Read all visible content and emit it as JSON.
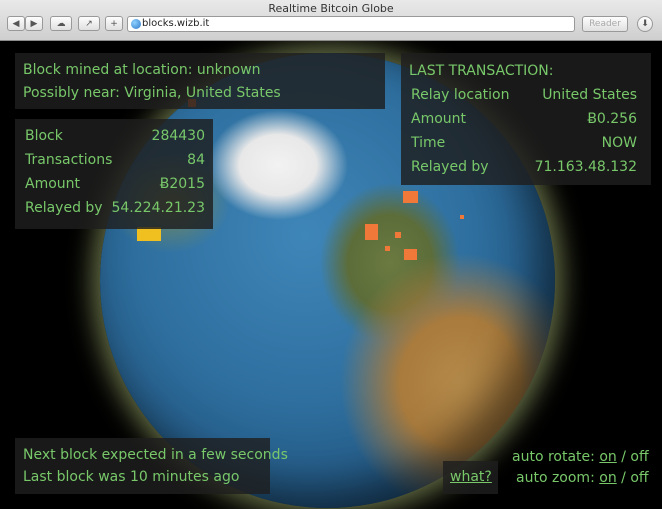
{
  "window": {
    "title": "Realtime Bitcoin Globe",
    "url": "blocks.wizb.it",
    "reader_label": "Reader",
    "toolbar_icons": [
      "back-icon",
      "forward-icon",
      "cloud-icon",
      "share-icon",
      "add-icon",
      "download-icon"
    ]
  },
  "block_location": {
    "mined_at": "Block mined at location: unknown",
    "possibly_near": "Possibly near: Virginia, United States"
  },
  "block_stats": [
    {
      "label": "Block",
      "value": "284430"
    },
    {
      "label": "Transactions",
      "value": "84"
    },
    {
      "label": "Amount",
      "value": "Ƀ2015"
    },
    {
      "label": "Relayed by",
      "value": "54.224.21.23"
    }
  ],
  "last_transaction": {
    "heading": "LAST TRANSACTION:",
    "rows": [
      {
        "label": "Relay location",
        "value": "United States"
      },
      {
        "label": "Amount",
        "value": "Ƀ0.256"
      },
      {
        "label": "Time",
        "value": "NOW"
      },
      {
        "label": "Relayed by",
        "value": "71.163.48.132"
      }
    ]
  },
  "footer": {
    "next_block": "Next block expected in a few seconds",
    "last_block": "Last block was 10 minutes ago",
    "what_link": "what?",
    "auto_rotate_label": "auto rotate:",
    "auto_zoom_label": "auto zoom:",
    "on": "on",
    "separator": "/",
    "off": "off"
  },
  "colors": {
    "text_green": "#78c86a",
    "marker_orange": "#f07838",
    "marker_yellow": "#f0c020"
  }
}
